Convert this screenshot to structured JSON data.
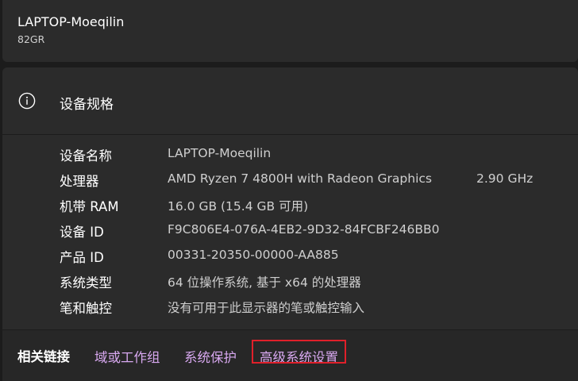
{
  "device": {
    "name": "LAPTOP-Moeqilin",
    "model": "82GR"
  },
  "specs": {
    "icon": "info-icon",
    "title": "设备规格",
    "rows": [
      {
        "label": "设备名称",
        "value": "LAPTOP-Moeqilin"
      },
      {
        "label": "处理器",
        "value": "AMD Ryzen 7 4800H with Radeon Graphics",
        "extra": "2.90 GHz"
      },
      {
        "label": "机带 RAM",
        "value": "16.0 GB (15.4 GB 可用)"
      },
      {
        "label": "设备 ID",
        "value": "F9C806E4-076A-4EB2-9D32-84FCBF246BB0"
      },
      {
        "label": "产品 ID",
        "value": "00331-20350-00000-AA885"
      },
      {
        "label": "系统类型",
        "value": "64 位操作系统, 基于 x64 的处理器"
      },
      {
        "label": "笔和触控",
        "value": "没有可用于此显示器的笔或触控输入"
      }
    ]
  },
  "related_links": {
    "title": "相关链接",
    "links": [
      "域或工作组",
      "系统保护",
      "高级系统设置"
    ]
  },
  "colors": {
    "background": "#1c1c1c",
    "card": "#2b2b2b",
    "link": "#d8a8f0",
    "highlight_box": "#e0202a"
  }
}
